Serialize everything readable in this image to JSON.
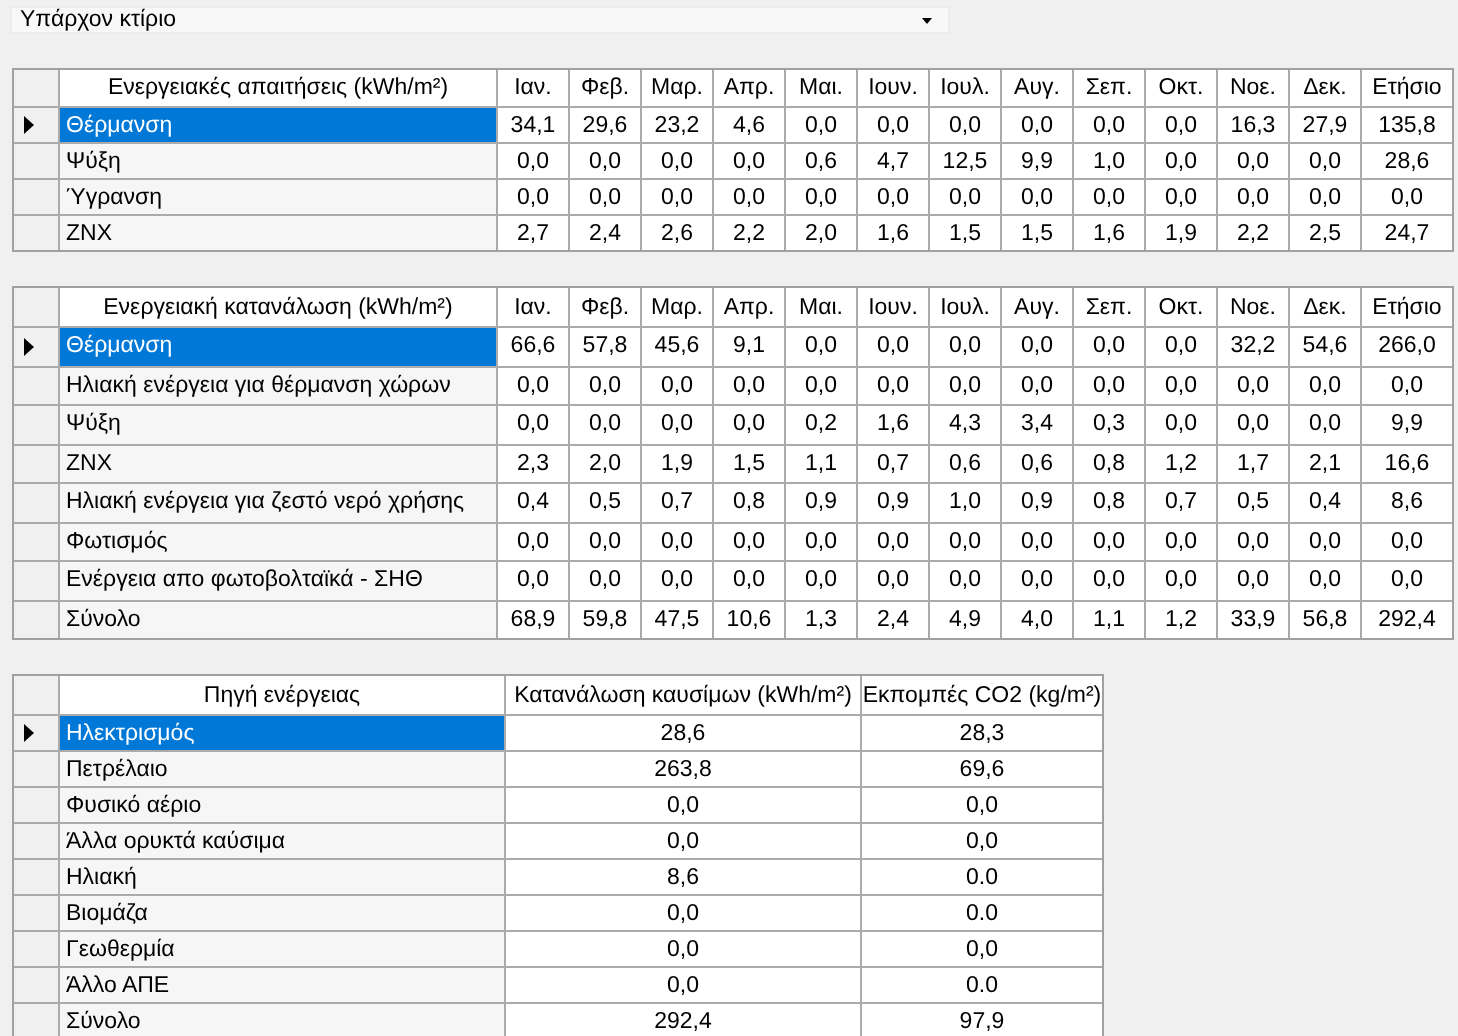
{
  "building_select": {
    "value": "Υπάρχον κτίριο"
  },
  "tables": [
    {
      "columns": [
        "Ενεργειακές απαιτήσεις (kWh/m²)",
        "Ιαν.",
        "Φεβ.",
        "Μαρ.",
        "Απρ.",
        "Μαι.",
        "Ιουν.",
        "Ιουλ.",
        "Αυγ.",
        "Σεπ.",
        "Οκτ.",
        "Νοε.",
        "Δεκ.",
        "Ετήσιο"
      ],
      "rows": [
        {
          "selected": true,
          "cells": [
            "Θέρμανση",
            "34,1",
            "29,6",
            "23,2",
            "4,6",
            "0,0",
            "0,0",
            "0,0",
            "0,0",
            "0,0",
            "0,0",
            "16,3",
            "27,9",
            "135,8"
          ]
        },
        {
          "selected": false,
          "cells": [
            "Ψύξη",
            "0,0",
            "0,0",
            "0,0",
            "0,0",
            "0,6",
            "4,7",
            "12,5",
            "9,9",
            "1,0",
            "0,0",
            "0,0",
            "0,0",
            "28,6"
          ]
        },
        {
          "selected": false,
          "cells": [
            "Ύγρανση",
            "0,0",
            "0,0",
            "0,0",
            "0,0",
            "0,0",
            "0,0",
            "0,0",
            "0,0",
            "0,0",
            "0,0",
            "0,0",
            "0,0",
            "0,0"
          ]
        },
        {
          "selected": false,
          "cells": [
            "ΖΝΧ",
            "2,7",
            "2,4",
            "2,6",
            "2,2",
            "2,0",
            "1,6",
            "1,5",
            "1,5",
            "1,6",
            "1,9",
            "2,2",
            "2,5",
            "24,7"
          ]
        }
      ]
    },
    {
      "columns": [
        "Ενεργειακή κατανάλωση (kWh/m²)",
        "Ιαν.",
        "Φεβ.",
        "Μαρ.",
        "Απρ.",
        "Μαι.",
        "Ιουν.",
        "Ιουλ.",
        "Αυγ.",
        "Σεπ.",
        "Οκτ.",
        "Νοε.",
        "Δεκ.",
        "Ετήσιο"
      ],
      "rows": [
        {
          "selected": true,
          "cells": [
            "Θέρμανση",
            "66,6",
            "57,8",
            "45,6",
            "9,1",
            "0,0",
            "0,0",
            "0,0",
            "0,0",
            "0,0",
            "0,0",
            "32,2",
            "54,6",
            "266,0"
          ]
        },
        {
          "selected": false,
          "cells": [
            "Ηλιακή ενέργεια για θέρμανση χώρων",
            "0,0",
            "0,0",
            "0,0",
            "0,0",
            "0,0",
            "0,0",
            "0,0",
            "0,0",
            "0,0",
            "0,0",
            "0,0",
            "0,0",
            "0,0"
          ]
        },
        {
          "selected": false,
          "cells": [
            "Ψύξη",
            "0,0",
            "0,0",
            "0,0",
            "0,0",
            "0,2",
            "1,6",
            "4,3",
            "3,4",
            "0,3",
            "0,0",
            "0,0",
            "0,0",
            "9,9"
          ]
        },
        {
          "selected": false,
          "cells": [
            "ΖΝΧ",
            "2,3",
            "2,0",
            "1,9",
            "1,5",
            "1,1",
            "0,7",
            "0,6",
            "0,6",
            "0,8",
            "1,2",
            "1,7",
            "2,1",
            "16,6"
          ]
        },
        {
          "selected": false,
          "cells": [
            "Ηλιακή ενέργεια για ζεστό νερό χρήσης",
            "0,4",
            "0,5",
            "0,7",
            "0,8",
            "0,9",
            "0,9",
            "1,0",
            "0,9",
            "0,8",
            "0,7",
            "0,5",
            "0,4",
            "8,6"
          ]
        },
        {
          "selected": false,
          "cells": [
            "Φωτισμός",
            "0,0",
            "0,0",
            "0,0",
            "0,0",
            "0,0",
            "0,0",
            "0,0",
            "0,0",
            "0,0",
            "0,0",
            "0,0",
            "0,0",
            "0,0"
          ]
        },
        {
          "selected": false,
          "cells": [
            "Ενέργεια απο φωτοβολταϊκά - ΣΗΘ",
            "0,0",
            "0,0",
            "0,0",
            "0,0",
            "0,0",
            "0,0",
            "0,0",
            "0,0",
            "0,0",
            "0,0",
            "0,0",
            "0,0",
            "0,0"
          ]
        },
        {
          "selected": false,
          "cells": [
            "Σύνολο",
            "68,9",
            "59,8",
            "47,5",
            "10,6",
            "1,3",
            "2,4",
            "4,9",
            "4,0",
            "1,1",
            "1,2",
            "33,9",
            "56,8",
            "292,4"
          ]
        }
      ]
    },
    {
      "columns": [
        "Πηγή ενέργειας",
        "Κατανάλωση καυσίμων (kWh/m²)",
        "Εκπομπές CO2 (kg/m²)"
      ],
      "rows": [
        {
          "selected": true,
          "cells": [
            "Ηλεκτρισμός",
            "28,6",
            "28,3"
          ]
        },
        {
          "selected": false,
          "cells": [
            "Πετρέλαιο",
            "263,8",
            "69,6"
          ]
        },
        {
          "selected": false,
          "cells": [
            "Φυσικό αέριο",
            "0,0",
            "0,0"
          ]
        },
        {
          "selected": false,
          "cells": [
            "Άλλα ορυκτά καύσιμα",
            "0,0",
            "0,0"
          ]
        },
        {
          "selected": false,
          "cells": [
            "Ηλιακή",
            "8,6",
            "0.0"
          ]
        },
        {
          "selected": false,
          "cells": [
            "Βιομάζα",
            "0,0",
            "0.0"
          ]
        },
        {
          "selected": false,
          "cells": [
            "Γεωθερμία",
            "0,0",
            "0,0"
          ]
        },
        {
          "selected": false,
          "cells": [
            "Άλλο ΑΠΕ",
            "0,0",
            "0.0"
          ]
        },
        {
          "selected": false,
          "cells": [
            "Σύνολο",
            "292,4",
            "97,9"
          ]
        }
      ]
    }
  ]
}
